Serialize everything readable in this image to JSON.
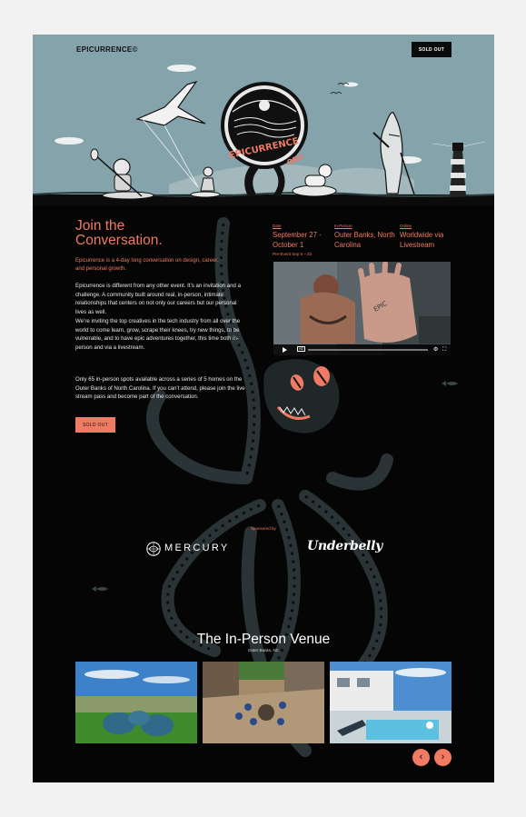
{
  "header": {
    "brand": "EPICURRENCE©",
    "cta_label": "SOLD OUT",
    "hero_logo_text": "EPICURRENCE OBX"
  },
  "intro": {
    "heading": "Join the Conversation.",
    "lead": "Epicurrence is a 4-day long conversation on design, career, and personal growth.",
    "paragraphs": [
      "Epicurrence is different from any other event. It’s an invitation and a challenge. A community built around real, in-person, intimate relationships that centers on not only our careers but our personal lives as well.",
      "We’re inviting the top creatives in the tech industry from all over the world to come learn, grow, scrape their knees, try new things, to be vulnerable, and to have epic adventures together, this time both in-person and via a livestream.",
      "Only 65 in-person spots available across a series of 5 homes on the Outer Banks of North Carolina. If you can’t attend, please join the live stream pass and become part of the conversation."
    ],
    "cta_label": "SOLD OUT"
  },
  "event_info": {
    "date_label": "Date",
    "date_value": "September 27 - October 1",
    "inperson_label": "In-Person",
    "inperson_value": "Outer Banks, North Carolina",
    "online_label": "Online",
    "online_value": "Worldwide via Livestream",
    "pre_event": "Pre-Event Sep 9 – 23"
  },
  "video": {
    "quality": "HD"
  },
  "sponsors": {
    "label": "Sponsored by",
    "items": [
      "MERCURY",
      "Underbelly"
    ]
  },
  "venue": {
    "title": "The In-Person Venue",
    "subtitle": "Outer Banks, NC"
  },
  "carousel": {
    "prev_icon": "chevron-left-icon",
    "next_icon": "chevron-right-icon",
    "prev_glyph": "‹",
    "next_glyph": "›"
  },
  "colors": {
    "accent": "#f07a62",
    "hero_sky": "#85a3ab",
    "page_bg": "#050505"
  }
}
